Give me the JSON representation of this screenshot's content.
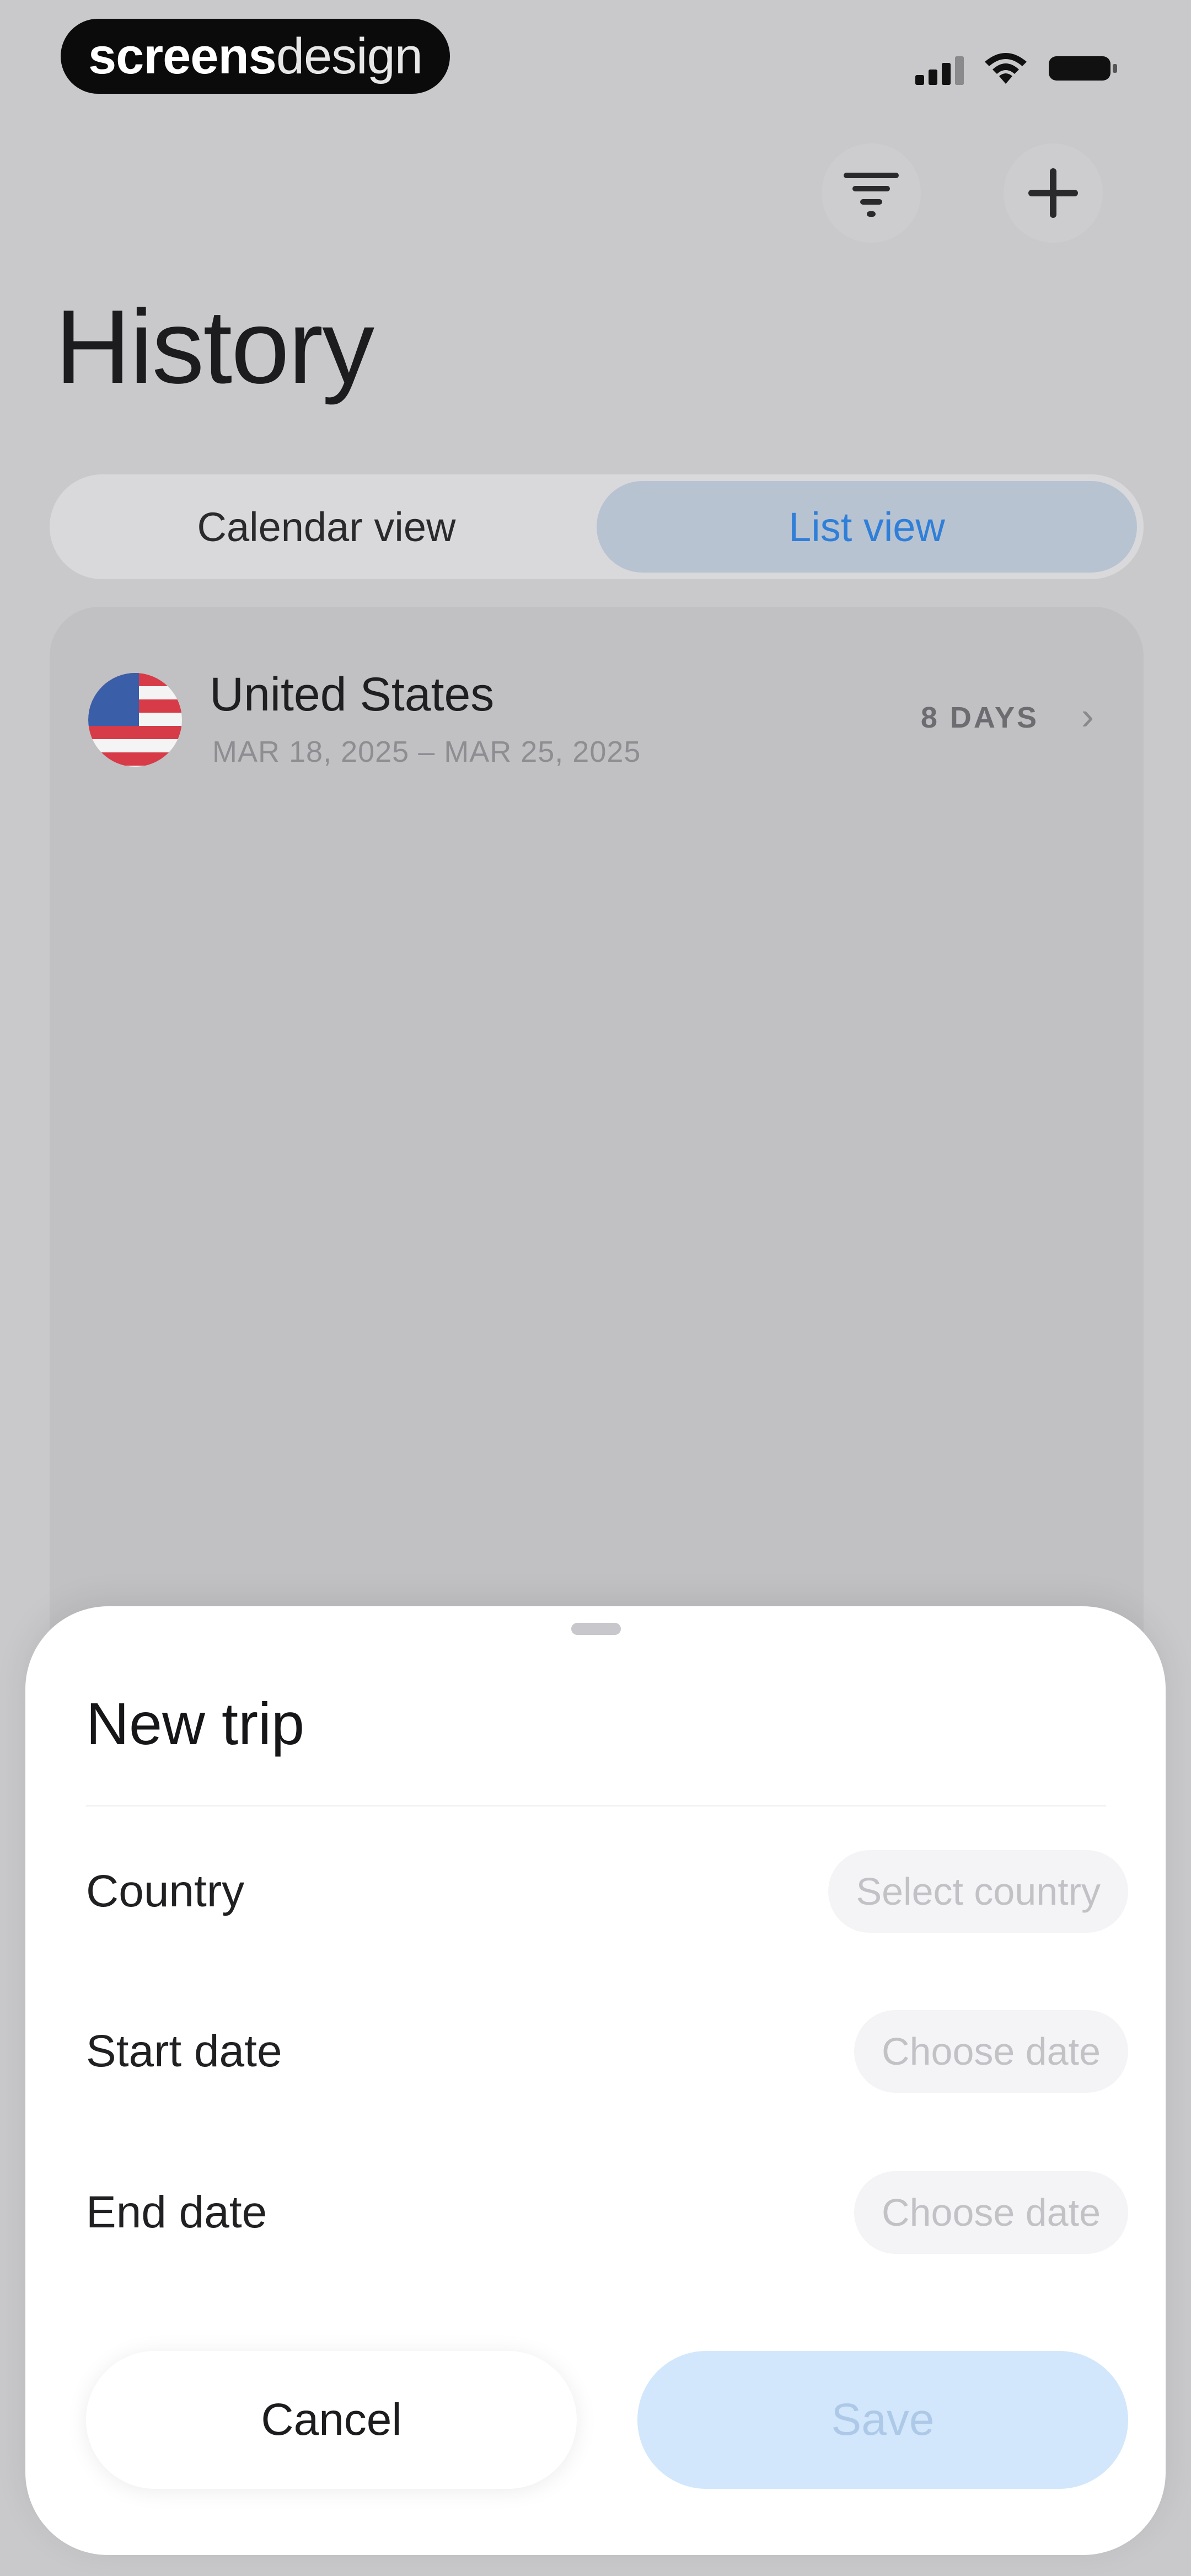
{
  "status_bar": {
    "brand_bold": "screens",
    "brand_light": "design",
    "icons": [
      "signal-icon",
      "wifi-icon",
      "battery-icon"
    ]
  },
  "header": {
    "title": "History",
    "actions": [
      "filter-icon",
      "plus-icon"
    ]
  },
  "view_toggle": {
    "options": [
      {
        "label": "Calendar view",
        "active": false
      },
      {
        "label": "List view",
        "active": true
      }
    ],
    "active_color": "#2f7fd8"
  },
  "trips": [
    {
      "country": "United States",
      "flag": "us-flag-icon",
      "dates": "MAR 18, 2025 – MAR 25, 2025",
      "duration": "8 DAYS"
    }
  ],
  "new_trip_sheet": {
    "title": "New trip",
    "fields": [
      {
        "label": "Country",
        "placeholder": "Select country"
      },
      {
        "label": "Start date",
        "placeholder": "Choose date"
      },
      {
        "label": "End date",
        "placeholder": "Choose date"
      }
    ],
    "cancel_label": "Cancel",
    "save_label": "Save",
    "save_color": "#d2e7fb"
  }
}
